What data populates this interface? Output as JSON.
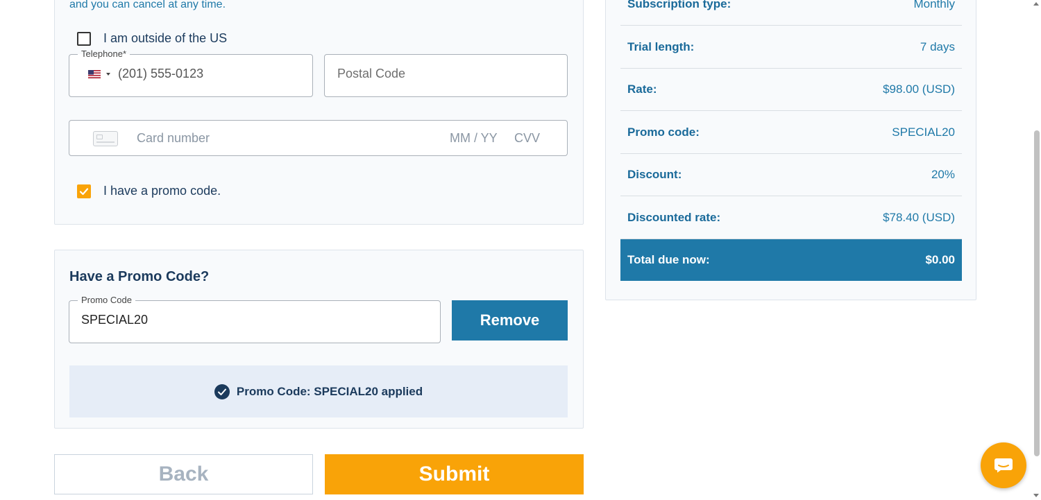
{
  "colors": {
    "accent_blue": "#1f79a8",
    "accent_orange": "#f9a308",
    "text_dark": "#1b3a5c",
    "applied_bg": "#e6edf7"
  },
  "payment": {
    "notice": "and you can cancel at any time.",
    "outside_us_label": "I am outside of the US",
    "outside_us_checked": false,
    "telephone": {
      "label": "Telephone*",
      "value": "(201) 555-0123",
      "flag_icon": "us-flag-icon"
    },
    "postal": {
      "placeholder": "Postal Code"
    },
    "card": {
      "number_placeholder": "Card number",
      "expiry_placeholder": "MM / YY",
      "cvv_placeholder": "CVV"
    },
    "promo_checkbox_label": "I have a promo code.",
    "promo_checked": true
  },
  "promo": {
    "title": "Have a Promo Code?",
    "field_label": "Promo Code",
    "field_value": "SPECIAL20",
    "remove_label": "Remove",
    "applied_message": "Promo Code: SPECIAL20 applied"
  },
  "actions": {
    "back_label": "Back",
    "submit_label": "Submit"
  },
  "summary": {
    "rows": [
      {
        "label": "Subscription type:",
        "value": "Monthly"
      },
      {
        "label": "Trial length:",
        "value": "7 days"
      },
      {
        "label": "Rate:",
        "value": "$98.00 (USD)"
      },
      {
        "label": "Promo code:",
        "value": "SPECIAL20"
      },
      {
        "label": "Discount:",
        "value": "20%"
      },
      {
        "label": "Discounted rate:",
        "value": "$78.40 (USD)"
      }
    ],
    "total": {
      "label": "Total due now:",
      "value": "$0.00"
    }
  }
}
